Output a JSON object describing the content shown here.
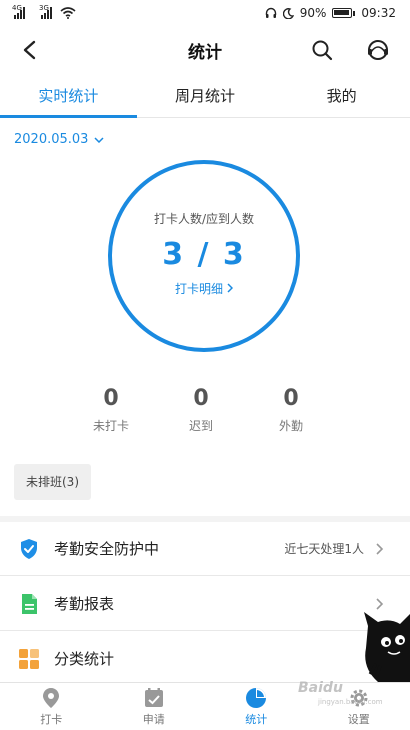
{
  "status_bar": {
    "signal_1": "4G",
    "signal_2": "3G",
    "battery": "90%",
    "time": "09:32"
  },
  "nav": {
    "title": "统计"
  },
  "tabs": [
    {
      "label": "实时统计",
      "active": true
    },
    {
      "label": "周月统计",
      "active": false
    },
    {
      "label": "我的",
      "active": false
    }
  ],
  "date_picker": {
    "value": "2020.05.03"
  },
  "ring": {
    "label": "打卡人数/应到人数",
    "value": "3 / 3",
    "link": "打卡明细"
  },
  "stats": [
    {
      "value": "0",
      "label": "未打卡"
    },
    {
      "value": "0",
      "label": "迟到"
    },
    {
      "value": "0",
      "label": "外勤"
    }
  ],
  "unscheduled_chip": "未排班(3)",
  "menu": [
    {
      "label": "考勤安全防护中",
      "detail": "近七天处理1人",
      "icon": "shield-check-icon",
      "color": "#1e8ee6"
    },
    {
      "label": "考勤报表",
      "detail": "",
      "icon": "report-document-icon",
      "color": "#3cc46a"
    },
    {
      "label": "分类统计",
      "detail": "",
      "icon": "category-grid-icon",
      "color": "#f3a23a"
    }
  ],
  "bottom_nav": [
    {
      "label": "打卡",
      "icon": "location-pin-icon",
      "active": false
    },
    {
      "label": "申请",
      "icon": "calendar-check-icon",
      "active": false
    },
    {
      "label": "统计",
      "icon": "pie-chart-icon",
      "active": true
    },
    {
      "label": "设置",
      "icon": "gear-icon",
      "active": false
    }
  ],
  "colors": {
    "accent": "#1a8ae0",
    "text": "#222222",
    "muted": "#777777"
  },
  "watermark": {
    "text": "Baidu",
    "sub": "jingyan.baidu.com"
  }
}
